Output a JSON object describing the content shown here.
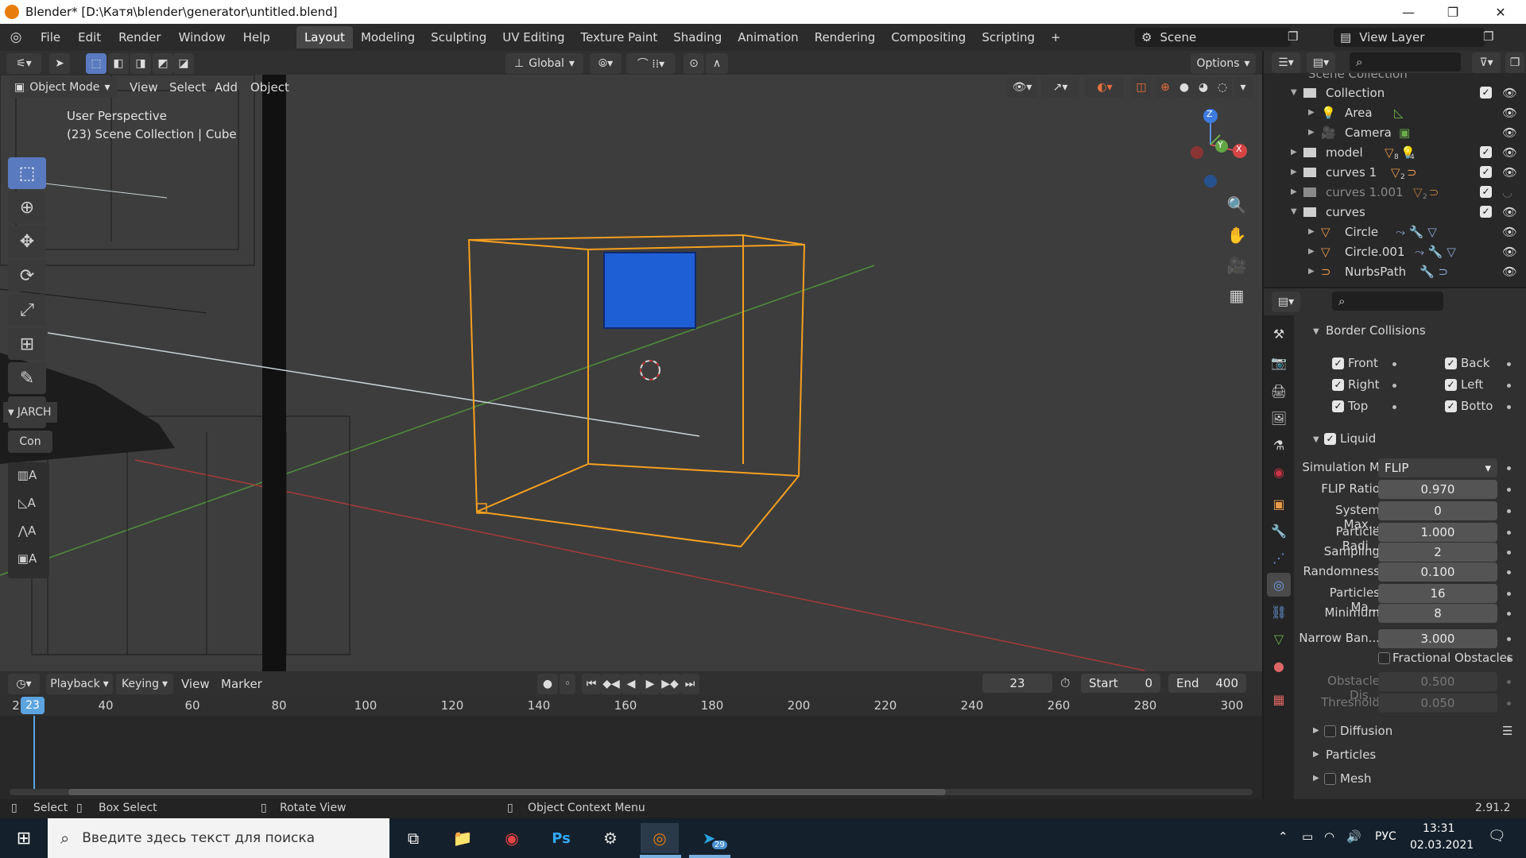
{
  "window": {
    "title": "Blender* [D:\\Катя\\blender\\generator\\untitled.blend]",
    "minimize": "—",
    "maximize": "❐",
    "close": "✕"
  },
  "menu": {
    "items": [
      "File",
      "Edit",
      "Render",
      "Window",
      "Help"
    ]
  },
  "workspaces": [
    "Layout",
    "Modeling",
    "Sculpting",
    "UV Editing",
    "Texture Paint",
    "Shading",
    "Animation",
    "Rendering",
    "Compositing",
    "Scripting",
    "+"
  ],
  "scene": {
    "name": "Scene",
    "view_layer": "View Layer"
  },
  "viewport": {
    "transform_orientation": "Global",
    "options_label": "Options",
    "mode": "Object Mode",
    "menu": [
      "View",
      "Select",
      "Add",
      "Object"
    ],
    "perspective": "User Perspective",
    "context": "(23) Scene Collection | Cube",
    "side_tab": "JARCH",
    "side_con": "Con",
    "axes": {
      "z": "Z",
      "y": "Y",
      "x": "X"
    },
    "colors": {
      "selection": "#f5a020",
      "fluid": "#1f5fd6",
      "x_axis": "#a83a3a",
      "y_axis": "#4f8f3a"
    }
  },
  "outliner": {
    "rows": [
      {
        "label": "Scene Collection",
        "type": "collection"
      },
      {
        "label": "Collection",
        "type": "collection"
      },
      {
        "label": "Area",
        "type": "light"
      },
      {
        "label": "Camera",
        "type": "camera"
      },
      {
        "label": "model",
        "type": "collection",
        "badge1": "8",
        "badge2": "4"
      },
      {
        "label": "curves 1",
        "type": "collection",
        "badge1": "2"
      },
      {
        "label": "curves 1.001",
        "type": "collection",
        "badge1": "2"
      },
      {
        "label": "curves",
        "type": "collection"
      },
      {
        "label": "Circle",
        "type": "curve"
      },
      {
        "label": "Circle.001",
        "type": "curve"
      },
      {
        "label": "NurbsPath",
        "type": "path"
      }
    ]
  },
  "properties": {
    "border_collisions": {
      "title": "Border Collisions",
      "front": "Front",
      "back": "Back",
      "right": "Right",
      "left": "Left",
      "top": "Top",
      "bottom": "Botto"
    },
    "liquid": {
      "title": "Liquid",
      "fields": [
        {
          "label": "Simulation M",
          "value": "FLIP"
        },
        {
          "label": "FLIP Ratio",
          "value": "0.970"
        },
        {
          "label": "System Max...",
          "value": "0"
        },
        {
          "label": "Particle Radi...",
          "value": "1.000"
        },
        {
          "label": "Sampling",
          "value": "2"
        },
        {
          "label": "Randomness",
          "value": "0.100"
        },
        {
          "label": "Particles Ma...",
          "value": "16"
        },
        {
          "label": "Minimum",
          "value": "8"
        },
        {
          "label": "Narrow Ban...",
          "value": "3.000"
        }
      ],
      "fractional": "Fractional Obstacles",
      "obstacle_label": "Obstacle Dis...",
      "obstacle_value": "0.500",
      "threshold_label": "Threshold",
      "threshold_value": "0.050"
    },
    "subpanels": {
      "diffusion": "Diffusion",
      "particles": "Particles",
      "mesh": "Mesh"
    }
  },
  "timeline": {
    "menu": [
      "Playback",
      "Keying",
      "View",
      "Marker"
    ],
    "current_frame": "23",
    "start_label": "Start",
    "start": "0",
    "end_label": "End",
    "end": "400",
    "ruler_first": "2",
    "ticks": [
      "40",
      "60",
      "80",
      "100",
      "120",
      "140",
      "160",
      "180",
      "200",
      "220",
      "240",
      "260",
      "280",
      "300"
    ]
  },
  "statusbar": {
    "select": "Select",
    "box_select": "Box Select",
    "rotate": "Rotate View",
    "context_menu": "Object Context Menu",
    "version": "2.91.2"
  },
  "taskbar": {
    "search_placeholder": "Введите здесь текст для поиска",
    "lang": "РУС",
    "time": "13:31",
    "date": "02.03.2021",
    "telegram_badge": "29"
  }
}
